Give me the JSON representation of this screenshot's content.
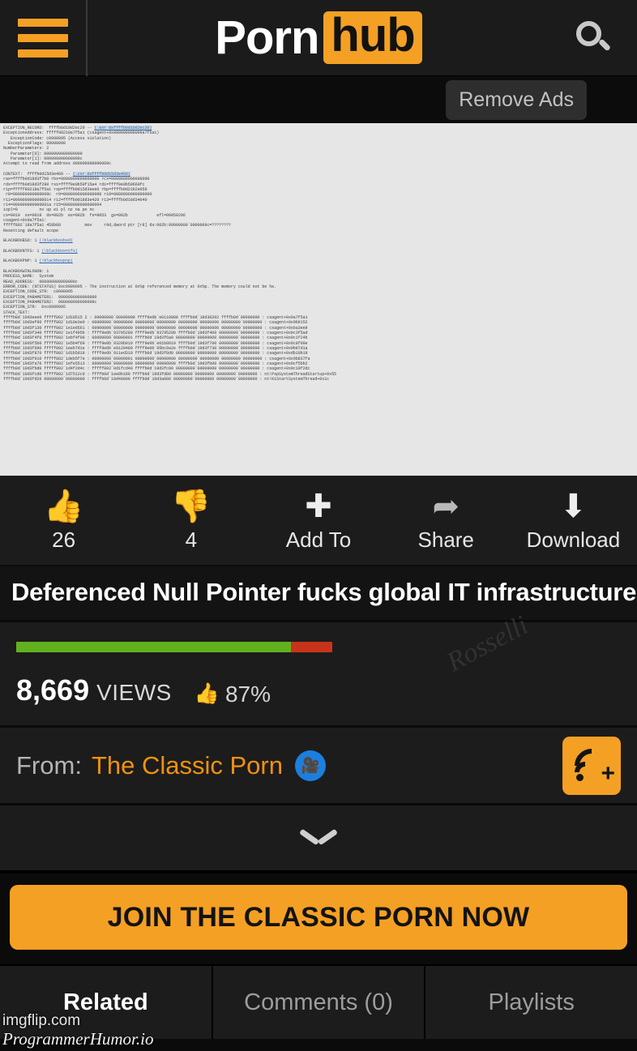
{
  "header": {
    "menu_icon": "hamburger-menu-icon",
    "logo_part1": "Porn",
    "logo_part2": "hub",
    "search_icon": "search-icon",
    "remove_ads_label": "Remove Ads"
  },
  "colors": {
    "brand_orange": "#f4a024",
    "page_background": "#0b0b0b",
    "panel_background": "#1c1c1c",
    "rating_green": "#62b01e",
    "rating_red": "#c8341a",
    "verified_blue": "#1b7fe0",
    "link_blue": "#1a5fb4"
  },
  "crash_dump": {
    "lines": [
      "EXCEPTION_RECORD:  ffffb0d19d2ec29 -- (.exr 0xffffb0d10d2ec20)",
      "ExceptionAddress: fffff80218a7f5a1 (csagent+0x000000000009a7f5a1)",
      "   ExceptionCode: c0000005 (Access violation)",
      "  ExceptionFlags: 00000000",
      "NumberParameters: 2",
      "   Parameter[0]: 0000000000000000",
      "   Parameter[1]: 000000000000009c",
      "Attempt to read from address 000000000000009c",
      "",
      "CONTEXT:  ffffb0d15d3e460 -- (.cxr 0xffffb0d15d3e460)",
      "rax=ffffb0d18d3f7b0 rbx=0000000000000000 rcx=0000000000000000",
      "rdx=ffffb0d18d3f290 rsi=ffff9e0b59f15a4 rdi=ffff9e0b59660fc",
      "rip=fffff80218a7f5a1 rsp=ffffb0d15d3eee0 rbp=ffffb0d21b2e050",
      " r8=000000000000009c  r9=0000000000000000 r10=0000000000000000",
      "r11=0000000000000014 r12=ffffb0d18d3e420 r13=ffffb0d18d34040",
      "r14=000000000000001a r15=0000000000000004",
      "iopl=0         nv up ei pl nz na po nc",
      "cs=0010  ss=0018  ds=002b  es=002b  fs=0053  gs=002b            efl=00050206",
      "csagent+0x9a7f5a1:",
      "fffff802`18a7f5a1 458b08          mov     r9d,dword ptr [r8] ds:002b:00000000`0000009c=????????",
      "Resetting default scope",
      "",
      "BLACKBOXBSD: 1 (!blackboxbsd)",
      "",
      "BLACKBOXNTFS: 1 (!blackboxntfs)",
      "",
      "BLACKBOXPNP: 1 (!blackboxpnp)",
      "",
      "BLACKBOXWINLOGON: 1",
      "PROCESS_NAME:  System",
      "READ_ADDRESS:  000000000000009c",
      "ERROR_CODE: (NTSTATUS) 0xc0000005 - The instruction at 0x%p referenced memory at 0x%p. The memory could not be %s.",
      "EXCEPTION_CODE_STR:  c0000005",
      "EXCEPTION_PARAMETER1:  0000000000000000",
      "EXCEPTION_PARAMETER2:  000000000000009c",
      "EXCEPTION_STR:  0xc0000005",
      "STACK_TEXT:"
    ],
    "stack_rows": [
      "ffffb0d`19d3eee0 fffff802`1d10515 2 : 00000000`00000000 ffff9e0b`e0110088 ffffb0d`18d38202 ffffb0d`00000000 : csagent+0x9a7f5a1",
      "ffffb0d`19d3ef00 fffff802`1d10e3e9 : 00000000`00000000 00000000`00000000 00000000`00000000 00000000`00000000 : csagent+0x9b9152",
      "ffffb0d`19d3f130 fffff802`1e1e9561 : 00000000`00000000 00000000`00000000 00000000`00000000 00000000`00000000 : csagent+0xba3ee9",
      "ffffb0d`19d3f340 fffff802`1e1f495b : ffff9e0b`93795280 ffff9e0b`93795280 ffffb0d`19d3f400 00000000`00000000 : csagent+0x9c3f5ad",
      "ffffb0d`19d3f4f0 fffff802`1ebf4f08 : 00000000`00000001 ffffb0d`19d3f6a0 00000000`00000000 00000000`00000000 : csagent+0x9c1f24b",
      "ffffb0d`19d3f5b0 fffff802`1e5b4f69 : ffff9e0b`9320b019 ffff9e0b`e01b0019 ffffb0d`19d3f700 00000000`00000000 : csagent+0x9c8f09e",
      "ffffb0d`19d3f690 fffff802`1eeb7d1e : ffff9e0b`e0120480 ffff9e0b`95bc9a2e ffffb0d`19d3f730 00000000`00000000 : csagent+0x9b87d1a",
      "ffffb0d`19d3f870 fffff802`1d1b5d19 : ffff9e0b`911ed310 ffffb0d`19d3f8d0 00000000`00000000 00000000`00000000 : csagent+0xdb10b19",
      "ffffb0d`19d3f910 fffff802`1deb5f7e : 00000000`00000001 00000000`00000000 00000000`00000000 00000000`00000000 : csagent+0x9b837fa",
      "ffffb0d`19d3fa70 fffff802`1efe5513 : 00000000`00000000 00000000`00000000 ffffb0d`19d3fb00 00000000`00000000 : csagent+0x9cf5bb2",
      "ffffb0d`19d3fbd0 fffff802`1d4f2d4c : fffff802`0d1fcd40 ffffb0d`19d3fc00 00000000`00000000 00000000`00000000 : csagent+0x9c19f2dc",
      "ffffb0d`19d3fcd0 fffff802`1d7512c0 : ffffb0d`1ee9b180 ffffb0d`19d3fd00 00000000`00000000 00000000`00000000 : nt!PspSystemThreadStartup+0x55",
      "ffffb0d`19d3fd20 00000000`00000000 : ffffb0d`19d40000 ffffb0d`19d3a000 00000000`00000000 00000000`00000000 : nt!KiStartSystemThread+0x1c"
    ]
  },
  "actions": [
    {
      "icon": "thumbs-up-icon",
      "glyph": "👍",
      "label": "26",
      "name": "like-button"
    },
    {
      "icon": "thumbs-down-icon",
      "glyph": "👎",
      "label": "4",
      "name": "dislike-button"
    },
    {
      "icon": "plus-icon",
      "glyph": "✚",
      "label": "Add To",
      "name": "add-to-button"
    },
    {
      "icon": "share-icon",
      "glyph": "☀",
      "label": "Share",
      "name": "share-button"
    },
    {
      "icon": "download-icon",
      "glyph": "⬇",
      "label": "Download",
      "name": "download-button"
    }
  ],
  "video": {
    "title": "Deferenced Null Pointer fucks global IT infrastructure",
    "views_count": "8,669",
    "views_label": "VIEWS",
    "rating_percent": "87%",
    "rating_value": 87,
    "from_label": "From:",
    "channel_name": "The Classic Porn",
    "verified_icon": "verified-camera-badge-icon",
    "subscribe_icon": "rss-subscribe-icon",
    "expand_icon": "chevron-down-icon"
  },
  "join_button_label": "JOIN THE CLASSIC PORN NOW",
  "tabs": [
    {
      "label": "Related",
      "active": true
    },
    {
      "label": "Comments (0)",
      "active": false
    },
    {
      "label": "Playlists",
      "active": false
    }
  ],
  "watermarks": {
    "video_watermark": "Rosselli",
    "source": "imgflip.com",
    "attribution": "ProgrammerHumor.io"
  }
}
